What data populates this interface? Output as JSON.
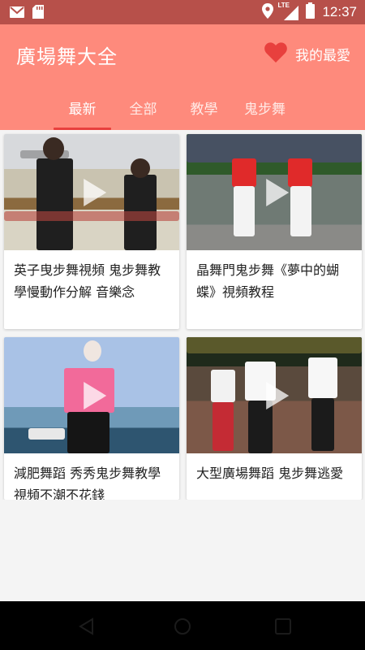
{
  "status_bar": {
    "time": "12:37",
    "network_label": "LTE",
    "icons": [
      "gmail-icon",
      "sd-card-icon",
      "location-icon",
      "signal-icon",
      "battery-icon"
    ]
  },
  "header": {
    "title": "廣場舞大全",
    "favorites_label": "我的最愛",
    "favorites_icon": "heart-icon",
    "accent_color": "#fe8a7c",
    "heart_color": "#e8403d"
  },
  "tabs": [
    {
      "label": "最新",
      "active": true
    },
    {
      "label": "全部",
      "active": false
    },
    {
      "label": "教學",
      "active": false
    },
    {
      "label": "鬼步舞",
      "active": false
    }
  ],
  "videos": [
    {
      "title": "英子曳步舞視頻 鬼步舞教學慢動作分解 音樂念",
      "icon": "play-icon"
    },
    {
      "title": "晶舞門鬼步舞《夢中的蝴蝶》視頻教程",
      "icon": "play-icon"
    },
    {
      "title": "減肥舞蹈 秀秀鬼步舞教學視頻不潮不花錢",
      "icon": "play-icon"
    },
    {
      "title": "大型廣場舞蹈 鬼步舞逃愛",
      "icon": "play-icon"
    }
  ],
  "nav": [
    "back-icon",
    "home-icon",
    "recents-icon"
  ]
}
